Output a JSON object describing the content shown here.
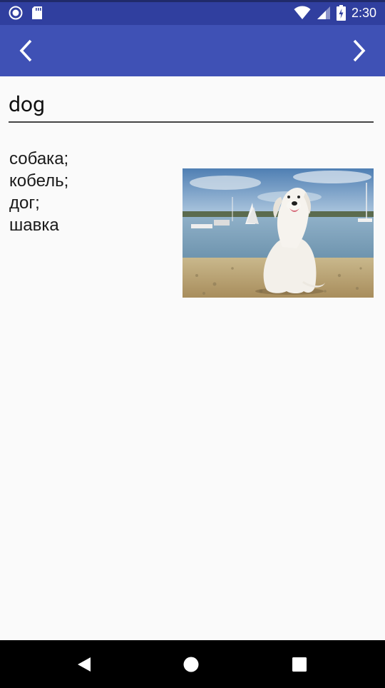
{
  "status_bar": {
    "time": "2:30",
    "icons": [
      "sync-circle-icon",
      "sd-card-icon",
      "wifi-icon",
      "cell-signal-icon",
      "battery-charging-icon"
    ]
  },
  "app_bar": {
    "prev_icon": "chevron-left-icon",
    "next_icon": "chevron-right-icon",
    "background": "#3f51b5",
    "status_background": "#303f9f"
  },
  "word": {
    "value": "dog"
  },
  "translations": [
    "собака;",
    "кобель;",
    "дог;",
    "шавка"
  ],
  "image": {
    "subject": "white dog sitting on a beach"
  },
  "nav_bar": {
    "icons": [
      "back-triangle-icon",
      "home-circle-icon",
      "recents-square-icon"
    ]
  }
}
